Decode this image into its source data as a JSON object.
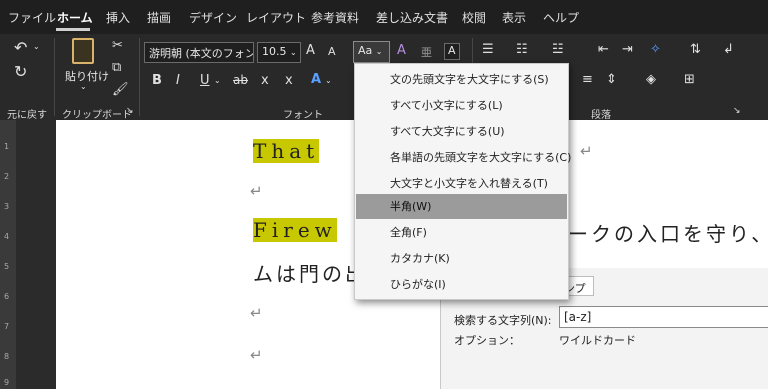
{
  "tabs": [
    {
      "label": "ファイル",
      "active": false
    },
    {
      "label": "ホーム",
      "active": true
    },
    {
      "label": "挿入",
      "active": false
    },
    {
      "label": "描画",
      "active": false
    },
    {
      "label": "デザイン",
      "active": false
    },
    {
      "label": "レイアウト",
      "active": false
    },
    {
      "label": "参考資料",
      "active": false
    },
    {
      "label": "差し込み文書",
      "active": false
    },
    {
      "label": "校閲",
      "active": false
    },
    {
      "label": "表示",
      "active": false
    },
    {
      "label": "ヘルプ",
      "active": false
    }
  ],
  "ribbon": {
    "font_name": "游明朝 (本文のフォン",
    "font_size": "10.5",
    "change_case_label": "Aa",
    "paste_label": "貼り付け",
    "groups": {
      "undo": "元に戻す",
      "clipboard": "クリップボード",
      "font": "フォント",
      "paragraph": "段落"
    },
    "buttons": {
      "grow_font": "A",
      "shrink_font": "A",
      "clear_format": "A",
      "bold": "B",
      "italic": "I",
      "underline": "U",
      "strike": "ab",
      "subscript": "x",
      "superscript": "x",
      "text_effects": "A",
      "char_border": "A"
    }
  },
  "change_case_menu": {
    "items": [
      {
        "label": "文の先頭文字を大文字にする(S)",
        "selected": false
      },
      {
        "label": "すべて小文字にする(L)",
        "selected": false
      },
      {
        "label": "すべて大文字にする(U)",
        "selected": false
      },
      {
        "label": "各単語の先頭文字を大文字にする(C)",
        "selected": false
      },
      {
        "label": "大文字と小文字を入れ替える(T)",
        "selected": false
      },
      {
        "label": "半角(W)",
        "selected": true
      },
      {
        "label": "全角(F)",
        "selected": false
      },
      {
        "label": "カタカナ(K)",
        "selected": false
      },
      {
        "label": "ひらがな(I)",
        "selected": false
      }
    ]
  },
  "document": {
    "line1_highlight": "That",
    "line3_highlight": "Firew",
    "line3_rest": "ークの入口を守り、",
    "line4_text": "ムは門の出",
    "paragraph_mark": "↵"
  },
  "find_dialog": {
    "tab_fragment": "ンプ",
    "search_label": "検索する文字列(N):",
    "search_value": "[a-z]",
    "options_label": "オプション：",
    "options_value": "ワイルドカード"
  },
  "ruler_numbers": [
    "1",
    "2",
    "3",
    "4",
    "5",
    "6",
    "7",
    "8",
    "9"
  ],
  "colors": {
    "highlight": "#c8c800",
    "selected_item": "#9b9b9b",
    "ribbon_bg": "#292929",
    "menubar_bg": "#1f1f1f"
  }
}
